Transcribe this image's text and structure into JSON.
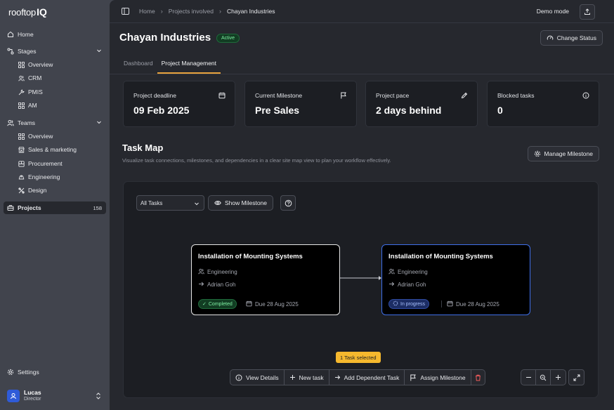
{
  "app": {
    "logo_main": "rooftop",
    "logo_suffix": "IQ"
  },
  "sidebar": {
    "home": "Home",
    "stages": {
      "label": "Stages",
      "items": [
        "Overview",
        "CRM",
        "PMIS",
        "AM"
      ]
    },
    "teams": {
      "label": "Teams",
      "items": [
        "Overview",
        "Sales & marketing",
        "Procurement",
        "Engineering",
        "Design"
      ]
    },
    "projects": {
      "label": "Projects",
      "count": "158"
    },
    "settings": "Settings",
    "user": {
      "name": "Lucas",
      "role": "Director"
    }
  },
  "topbar": {
    "breadcrumb": [
      "Home",
      "Projects involved",
      "Chayan Industries"
    ],
    "demo_mode": "Demo mode"
  },
  "header": {
    "title": "Chayan Industries",
    "status_badge": "Active",
    "change_status": "Change Status"
  },
  "tabs": [
    {
      "label": "Dashboard",
      "active": false
    },
    {
      "label": "Project Management",
      "active": true
    }
  ],
  "cards": [
    {
      "label": "Project deadline",
      "value": "09 Feb 2025",
      "icon": "calendar-icon"
    },
    {
      "label": "Current Milestone",
      "value": "Pre Sales",
      "icon": "flag-icon"
    },
    {
      "label": "Project pace",
      "value": "2 days behind",
      "icon": "pencil-icon"
    },
    {
      "label": "Blocked tasks",
      "value": "0",
      "icon": "info-icon"
    }
  ],
  "task_map": {
    "title": "Task Map",
    "subtitle": "Visualize task connections, milestones, and dependencies in a clear site map view to plan your workflow effectively.",
    "manage_milestone": "Manage Milestone",
    "filter_value": "All Tasks",
    "show_milestone": "Show Milestone",
    "nodes": [
      {
        "title": "Installation of Mounting Systems",
        "team": "Engineering",
        "assignee": "Adrian Goh",
        "status": "Completed",
        "due": "Due 28 Aug 2025"
      },
      {
        "title": "Installation of Mounting Systems",
        "team": "Engineering",
        "assignee": "Adrian Goh",
        "status": "In progress",
        "due": "Due 28 Aug 2025"
      }
    ],
    "selected_badge": "1 Task selected",
    "actions": {
      "view_details": "View Details",
      "new_task": "New task",
      "add_dependent": "Add Dependent Task",
      "assign_milestone": "Assign Milestone"
    }
  },
  "colors": {
    "accent_tab": "#e8a33d",
    "selected_badge": "#f5b82e",
    "blue_border": "#3f6fe8",
    "avatar": "#2f5bd8"
  }
}
